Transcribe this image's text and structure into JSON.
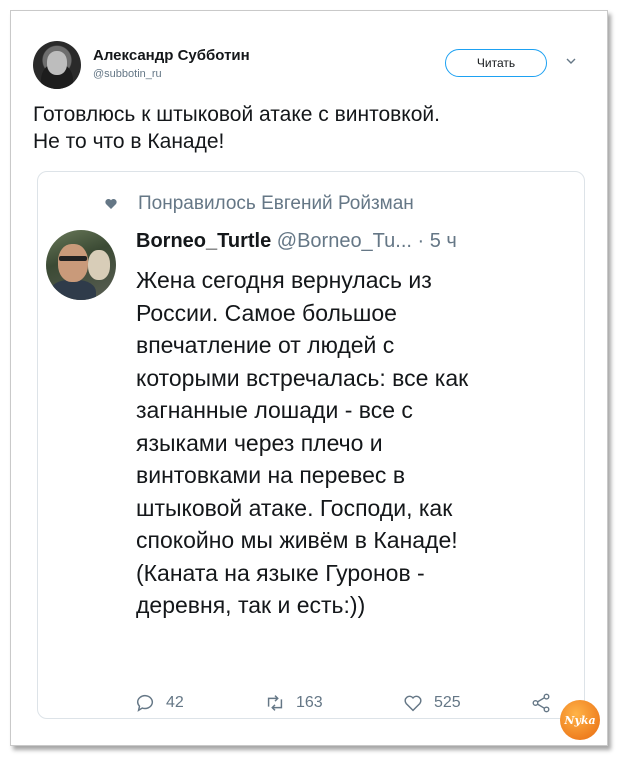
{
  "author": {
    "name": "Александр Субботин",
    "handle": "@subbotin_ru"
  },
  "follow_button": "Читать",
  "tweet": {
    "lines": [
      "Готовлюсь к штыковой атаке с винтовкой.",
      "Не то что в Канаде!"
    ]
  },
  "quote": {
    "liked_by": "Понравилось Евгений Ройзман",
    "name": "Borneo_Turtle",
    "handle": "@Borneo_Tu...",
    "time": "· 5 ч",
    "lines": [
      "Жена сегодня вернулась из",
      "России. Самое большое",
      "впечатление от людей с",
      "которыми встречалась: все как",
      "загнанные лошади - все с",
      "языками через плечо и",
      "винтовками на перевес в",
      "штыковой атаке. Господи, как",
      "спокойно мы живём в Канаде!",
      "(Каната на языке Гуронов -",
      "деревня, так и есть:))"
    ],
    "stats": {
      "replies": "42",
      "retweets": "163",
      "likes": "525"
    }
  },
  "watermark": "Nyka",
  "icons": {
    "chevron": "chevron-down-icon",
    "liked": "heart-icon",
    "reply": "reply-icon",
    "retweet": "retweet-icon",
    "like": "like-icon",
    "share": "share-icon"
  },
  "colors": {
    "accent": "#1da1f2",
    "secondary_text": "#657786",
    "text": "#14171a",
    "border": "#dde3e8"
  }
}
